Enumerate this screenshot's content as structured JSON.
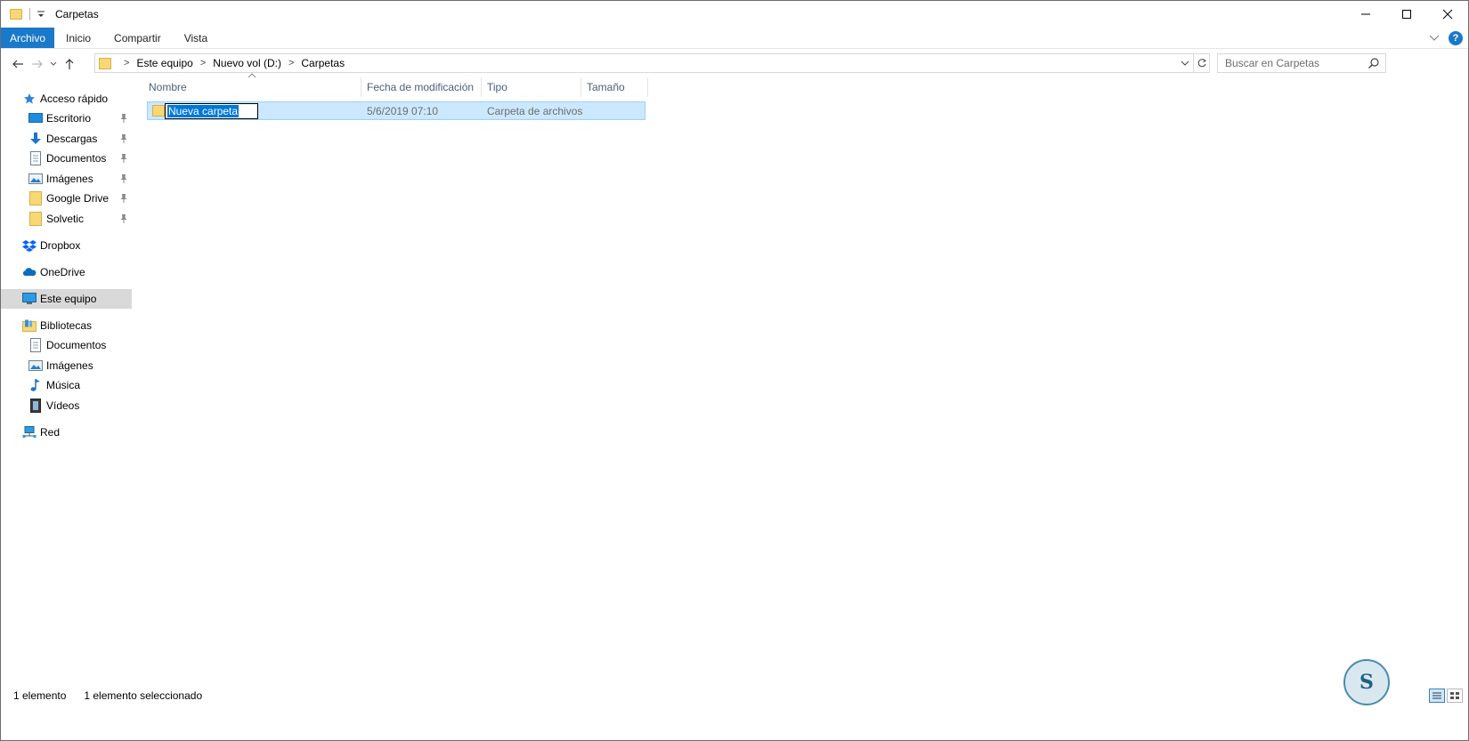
{
  "window": {
    "title": "Carpetas"
  },
  "ribbon": {
    "tabs": [
      {
        "label": "Archivo",
        "active": true
      },
      {
        "label": "Inicio"
      },
      {
        "label": "Compartir"
      },
      {
        "label": "Vista"
      }
    ],
    "help": "?"
  },
  "navigation": {
    "breadcrumb": [
      "Este equipo",
      "Nuevo vol (D:)",
      "Carpetas"
    ],
    "search_placeholder": "Buscar en Carpetas"
  },
  "sidebar": {
    "quick_access": "Acceso rápido",
    "pinned": [
      {
        "label": "Escritorio",
        "icon": "desktop-icon"
      },
      {
        "label": "Descargas",
        "icon": "download-icon"
      },
      {
        "label": "Documentos",
        "icon": "document-icon"
      },
      {
        "label": "Imágenes",
        "icon": "pictures-icon"
      },
      {
        "label": "Google Drive",
        "icon": "folder-icon"
      },
      {
        "label": "Solvetic",
        "icon": "folder-icon"
      }
    ],
    "dropbox": "Dropbox",
    "onedrive": "OneDrive",
    "this_pc": "Este equipo",
    "libraries": "Bibliotecas",
    "library_items": [
      {
        "label": "Documentos",
        "icon": "document-icon"
      },
      {
        "label": "Imágenes",
        "icon": "pictures-icon"
      },
      {
        "label": "Música",
        "icon": "music-icon"
      },
      {
        "label": "Vídeos",
        "icon": "video-icon"
      }
    ],
    "network": "Red"
  },
  "columns": {
    "name": "Nombre",
    "modified": "Fecha de modificación",
    "type": "Tipo",
    "size": "Tamaño"
  },
  "files": [
    {
      "name": "Nueva carpeta",
      "modified": "5/6/2019 07:10",
      "type": "Carpeta de archivos",
      "size": "",
      "selected": true,
      "renaming": true
    }
  ],
  "status": {
    "count": "1 elemento",
    "selected": "1 elemento seleccionado"
  },
  "colors": {
    "accent": "#1979ca",
    "selection_bg": "#cce8ff",
    "selection_border": "#99d1ff",
    "header_text": "#4c607a",
    "folder": "#f8d775"
  }
}
